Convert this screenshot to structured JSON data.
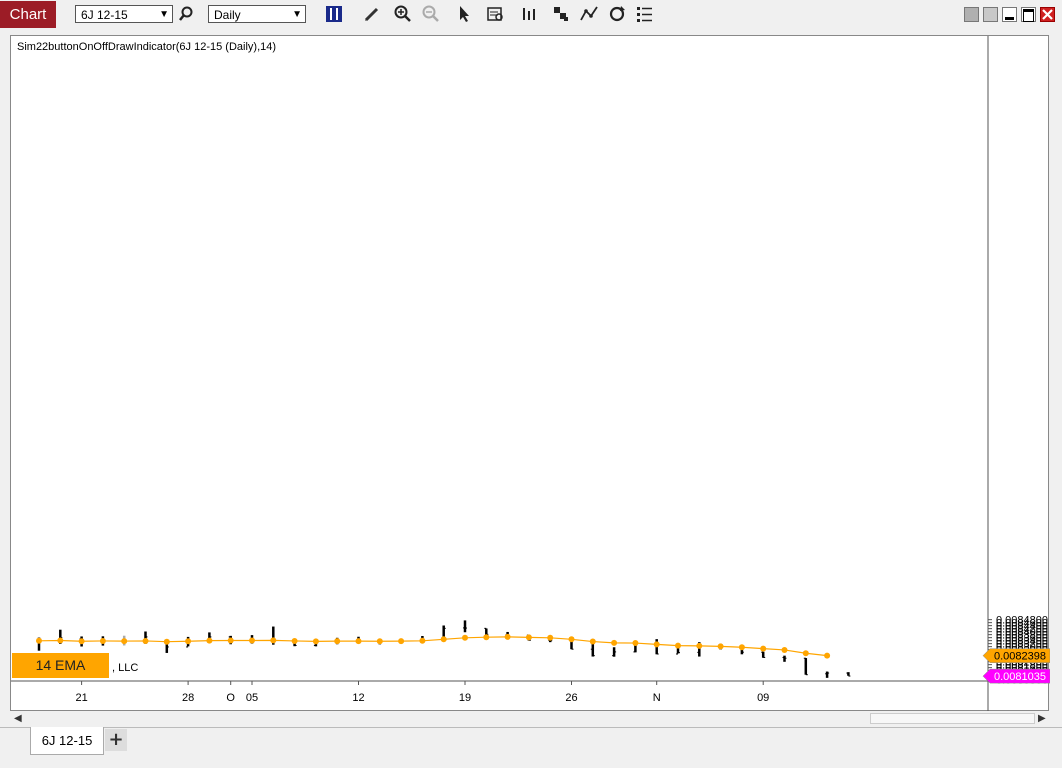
{
  "toolbar": {
    "title": "Chart",
    "instrument": "6J 12-15",
    "period": "Daily",
    "icons": [
      "search-icon",
      "bar-chart-style-icon",
      "pencil-draw-icon",
      "zoom-in-icon",
      "zoom-out-icon",
      "pointer-icon",
      "data-box-icon",
      "bar-spacing-icon",
      "chart-style-icon",
      "drawing-tools-icon",
      "reload-icon",
      "properties-icon"
    ],
    "window_icons": [
      "tile-icon",
      "restore-icon",
      "minimize-icon",
      "maximize-icon",
      "close-icon"
    ]
  },
  "chart": {
    "indicator_label": "Sim22buttonOnOffDrawIndicator(6J 12-15 (Daily),14)",
    "legend_label": "14 EMA",
    "legend_suffix": ", LLC",
    "price_ticks": [
      "0.0084800",
      "0.0084600",
      "0.0084400",
      "0.0084200",
      "0.0084000",
      "0.0083800",
      "0.0083600",
      "0.0083400",
      "0.0083200",
      "0.0083000",
      "0.0082800",
      "0.0082600",
      "0.0082200",
      "0.0082000",
      "0.0081800",
      "0.0081600",
      "0.0081400",
      "0.0081200",
      "0.0081000",
      "0.0080800"
    ],
    "date_ticks": [
      {
        "label": "21",
        "bar": 2
      },
      {
        "label": "28",
        "bar": 7
      },
      {
        "label": "O",
        "bar": 9
      },
      {
        "label": "05",
        "bar": 10
      },
      {
        "label": "12",
        "bar": 15
      },
      {
        "label": "19",
        "bar": 20
      },
      {
        "label": "26",
        "bar": 25
      },
      {
        "label": "N",
        "bar": 29
      },
      {
        "label": "09",
        "bar": 34
      }
    ],
    "ema_marker": "0.0082398",
    "last_price_marker": "0.0081035",
    "ema_color": "#ffa500",
    "last_price_color": "#ff00ff"
  },
  "chart_data": {
    "type": "ohlc",
    "y_range": [
      0.00806,
      0.00849
    ],
    "bars": [
      {
        "high": 0.008361,
        "low": 0.008273,
        "open": 0.008328,
        "close": 0.008333
      },
      {
        "high": 0.008413,
        "low": 0.008318,
        "open": 0.008348,
        "close": 0.00836
      },
      {
        "high": 0.008368,
        "low": 0.008301,
        "open": 0.008352,
        "close": 0.00833
      },
      {
        "high": 0.008369,
        "low": 0.008307,
        "open": 0.00833,
        "close": 0.008343
      },
      {
        "high": 0.008373,
        "low": 0.008308,
        "open": 0.00834,
        "close": 0.008331
      },
      {
        "high": 0.008401,
        "low": 0.008319,
        "open": 0.008335,
        "close": 0.008365
      },
      {
        "high": 0.008345,
        "low": 0.008258,
        "open": 0.008338,
        "close": 0.008298
      },
      {
        "high": 0.008365,
        "low": 0.008302,
        "open": 0.008298,
        "close": 0.008338
      },
      {
        "high": 0.008395,
        "low": 0.008329,
        "open": 0.00834,
        "close": 0.008365
      },
      {
        "high": 0.008372,
        "low": 0.008316,
        "open": 0.008365,
        "close": 0.008343
      },
      {
        "high": 0.008377,
        "low": 0.00832,
        "open": 0.008343,
        "close": 0.008345
      },
      {
        "high": 0.008434,
        "low": 0.008313,
        "open": 0.008345,
        "close": 0.008348
      },
      {
        "high": 0.00835,
        "low": 0.008303,
        "open": 0.008343,
        "close": 0.008308
      },
      {
        "high": 0.008346,
        "low": 0.008302,
        "open": 0.008308,
        "close": 0.008325
      },
      {
        "high": 0.008359,
        "low": 0.008316,
        "open": 0.008326,
        "close": 0.008345
      },
      {
        "high": 0.008366,
        "low": 0.008329,
        "open": 0.008344,
        "close": 0.008333
      },
      {
        "high": 0.008351,
        "low": 0.008315,
        "open": 0.008333,
        "close": 0.008331
      },
      {
        "high": 0.008347,
        "low": 0.00832,
        "open": 0.00833,
        "close": 0.00834
      },
      {
        "high": 0.008371,
        "low": 0.008335,
        "open": 0.00834,
        "close": 0.008338
      },
      {
        "high": 0.008441,
        "low": 0.008354,
        "open": 0.008338,
        "close": 0.008422
      },
      {
        "high": 0.008475,
        "low": 0.008396,
        "open": 0.008425,
        "close": 0.008424
      },
      {
        "high": 0.008421,
        "low": 0.008346,
        "open": 0.008422,
        "close": 0.008382
      },
      {
        "high": 0.008398,
        "low": 0.008354,
        "open": 0.00838,
        "close": 0.008377
      },
      {
        "high": 0.008379,
        "low": 0.00834,
        "open": 0.008377,
        "close": 0.008343
      },
      {
        "high": 0.008364,
        "low": 0.00833,
        "open": 0.008343,
        "close": 0.00834
      },
      {
        "high": 0.008365,
        "low": 0.008283,
        "open": 0.00834,
        "close": 0.008283
      },
      {
        "high": 0.008322,
        "low": 0.008234,
        "open": 0.008283,
        "close": 0.00824
      },
      {
        "high": 0.008296,
        "low": 0.008233,
        "open": 0.00824,
        "close": 0.008265
      },
      {
        "high": 0.008326,
        "low": 0.008262,
        "open": 0.008265,
        "close": 0.00832
      },
      {
        "high": 0.00835,
        "low": 0.008249,
        "open": 0.008318,
        "close": 0.008251
      },
      {
        "high": 0.008296,
        "low": 0.008255,
        "open": 0.008251,
        "close": 0.00826
      },
      {
        "high": 0.00833,
        "low": 0.008234,
        "open": 0.008262,
        "close": 0.00831
      },
      {
        "high": 0.008319,
        "low": 0.008281,
        "open": 0.00831,
        "close": 0.008297
      },
      {
        "high": 0.008295,
        "low": 0.008249,
        "open": 0.008297,
        "close": 0.008263
      },
      {
        "high": 0.008266,
        "low": 0.008226,
        "open": 0.008263,
        "close": 0.008228
      },
      {
        "high": 0.00824,
        "low": 0.008199,
        "open": 0.008228,
        "close": 0.008223
      },
      {
        "high": 0.008224,
        "low": 0.008113,
        "open": 0.008223,
        "close": 0.008113
      },
      {
        "high": 0.008134,
        "low": 0.008092,
        "open": 0.008119,
        "close": 0.008124
      },
      {
        "high": 0.00813,
        "low": 0.008106,
        "open": 0.008124,
        "close": 0.008104
      }
    ],
    "gray_bar_index": 4,
    "ema": [
      0.008339,
      0.008341,
      0.008336,
      0.008338,
      0.008337,
      0.008338,
      0.008333,
      0.008336,
      0.00834,
      0.008341,
      0.008341,
      0.008342,
      0.008338,
      0.008335,
      0.008337,
      0.008337,
      0.008336,
      0.008337,
      0.008339,
      0.008349,
      0.008359,
      0.008363,
      0.008365,
      0.008362,
      0.008359,
      0.008349,
      0.008334,
      0.008325,
      0.008324,
      0.008315,
      0.008307,
      0.008305,
      0.008302,
      0.008296,
      0.008287,
      0.008278,
      0.008256,
      0.00824
    ]
  }
}
